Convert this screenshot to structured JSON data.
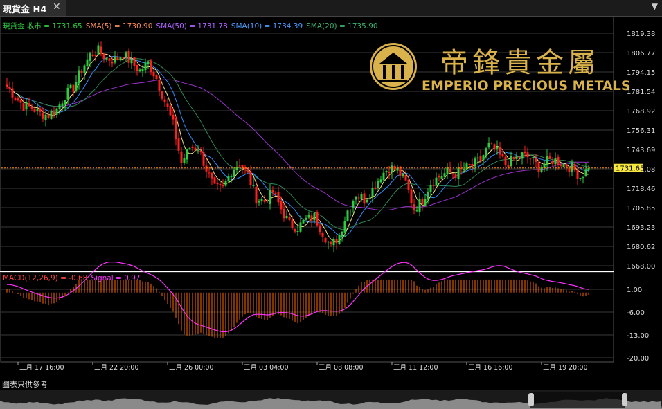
{
  "window": {
    "tab_title": "現貨金 H4",
    "close_glyph": "✕",
    "menu_glyph": "▼"
  },
  "footer_note": "圖表只供參考",
  "logo": {
    "chinese": "帝鋒貴金屬",
    "english": "EMPERIO PRECIOUS METALS",
    "color": "#d9b24c"
  },
  "colors": {
    "bull": "#2ecc40",
    "bear": "#ff2020",
    "sma5": "#f0e68c",
    "sma10": "#2f8fff",
    "sma20": "#2e8b57",
    "sma50": "#9932cc",
    "macd_hist": "#ff6a00",
    "signal": "#ff33ff",
    "grid": "#3a3a3a"
  },
  "chart_data": [
    {
      "type": "candlestick",
      "legend": [
        {
          "text": "現貨金 收市 = 1731.65",
          "color": "#2ecc40"
        },
        {
          "text": "SMA(5) = 1730.90",
          "color": "#ff8c5a"
        },
        {
          "text": "SMA(50) = 1731.78",
          "color": "#b060ff"
        },
        {
          "text": "SMA(10) = 1734.39",
          "color": "#4a9cff"
        },
        {
          "text": "SMA(20) = 1735.90",
          "color": "#3cb371"
        }
      ],
      "y_ticks": [
        "1819.38",
        "1806.77",
        "1794.15",
        "1781.54",
        "1768.92",
        "1756.31",
        "1743.69",
        "1731.08",
        "1718.46",
        "1705.85",
        "1693.23",
        "1680.62",
        "1668.00"
      ],
      "ylim": [
        1668.0,
        1825.0
      ],
      "last_price_label": "1731.65",
      "last_price": 1731.65,
      "x_ticks": [
        "二月 17 16:00",
        "二月 22 20:00",
        "二月 26 00:00",
        "三月 03 04:00",
        "三月 08 08:00",
        "三月 11 12:00",
        "三月 16 16:00",
        "三月 19 20:00"
      ],
      "x_tick_index": [
        4,
        31,
        58,
        85,
        112,
        139,
        166,
        193
      ],
      "anchors_close": [
        [
          0,
          1785
        ],
        [
          3,
          1778
        ],
        [
          6,
          1772
        ],
        [
          9,
          1771
        ],
        [
          12,
          1767
        ],
        [
          15,
          1766
        ],
        [
          18,
          1770
        ],
        [
          21,
          1779
        ],
        [
          24,
          1784
        ],
        [
          27,
          1796
        ],
        [
          30,
          1805
        ],
        [
          33,
          1808
        ],
        [
          36,
          1803
        ],
        [
          39,
          1802
        ],
        [
          42,
          1806
        ],
        [
          45,
          1800
        ],
        [
          48,
          1795
        ],
        [
          51,
          1800
        ],
        [
          54,
          1790
        ],
        [
          57,
          1775
        ],
        [
          60,
          1760
        ],
        [
          63,
          1735
        ],
        [
          66,
          1745
        ],
        [
          69,
          1745
        ],
        [
          72,
          1731
        ],
        [
          75,
          1718
        ],
        [
          78,
          1718
        ],
        [
          81,
          1730
        ],
        [
          84,
          1735
        ],
        [
          87,
          1727
        ],
        [
          90,
          1712
        ],
        [
          93,
          1710
        ],
        [
          96,
          1716
        ],
        [
          99,
          1705
        ],
        [
          102,
          1695
        ],
        [
          105,
          1693
        ],
        [
          108,
          1698
        ],
        [
          111,
          1700
        ],
        [
          114,
          1690
        ],
        [
          117,
          1680
        ],
        [
          120,
          1688
        ],
        [
          123,
          1704
        ],
        [
          126,
          1715
        ],
        [
          129,
          1711
        ],
        [
          132,
          1718
        ],
        [
          135,
          1727
        ],
        [
          138,
          1732
        ],
        [
          141,
          1730
        ],
        [
          144,
          1722
        ],
        [
          147,
          1705
        ],
        [
          150,
          1711
        ],
        [
          153,
          1722
        ],
        [
          156,
          1726
        ],
        [
          159,
          1729
        ],
        [
          162,
          1728
        ],
        [
          165,
          1731
        ],
        [
          168,
          1733
        ],
        [
          171,
          1737
        ],
        [
          174,
          1746
        ],
        [
          177,
          1742
        ],
        [
          180,
          1734
        ],
        [
          183,
          1737
        ],
        [
          186,
          1740
        ],
        [
          189,
          1738
        ],
        [
          192,
          1732
        ],
        [
          195,
          1736
        ],
        [
          198,
          1737
        ],
        [
          201,
          1734
        ],
        [
          204,
          1732
        ],
        [
          207,
          1726
        ],
        [
          210,
          1731.65
        ]
      ],
      "volatility": 4.5
    },
    {
      "type": "macd",
      "legend": [
        {
          "text": "MACD(12,26,9) = -0.68",
          "color": "#ff4040"
        },
        {
          "text": "Signal = 0.97",
          "color": "#ff33ff"
        }
      ],
      "y_ticks": [
        "1.00",
        "-6.00",
        "-13.00",
        "-20.00"
      ],
      "ylim": [
        -21.5,
        4.5
      ],
      "macd": -0.68,
      "signal": 0.97
    }
  ]
}
